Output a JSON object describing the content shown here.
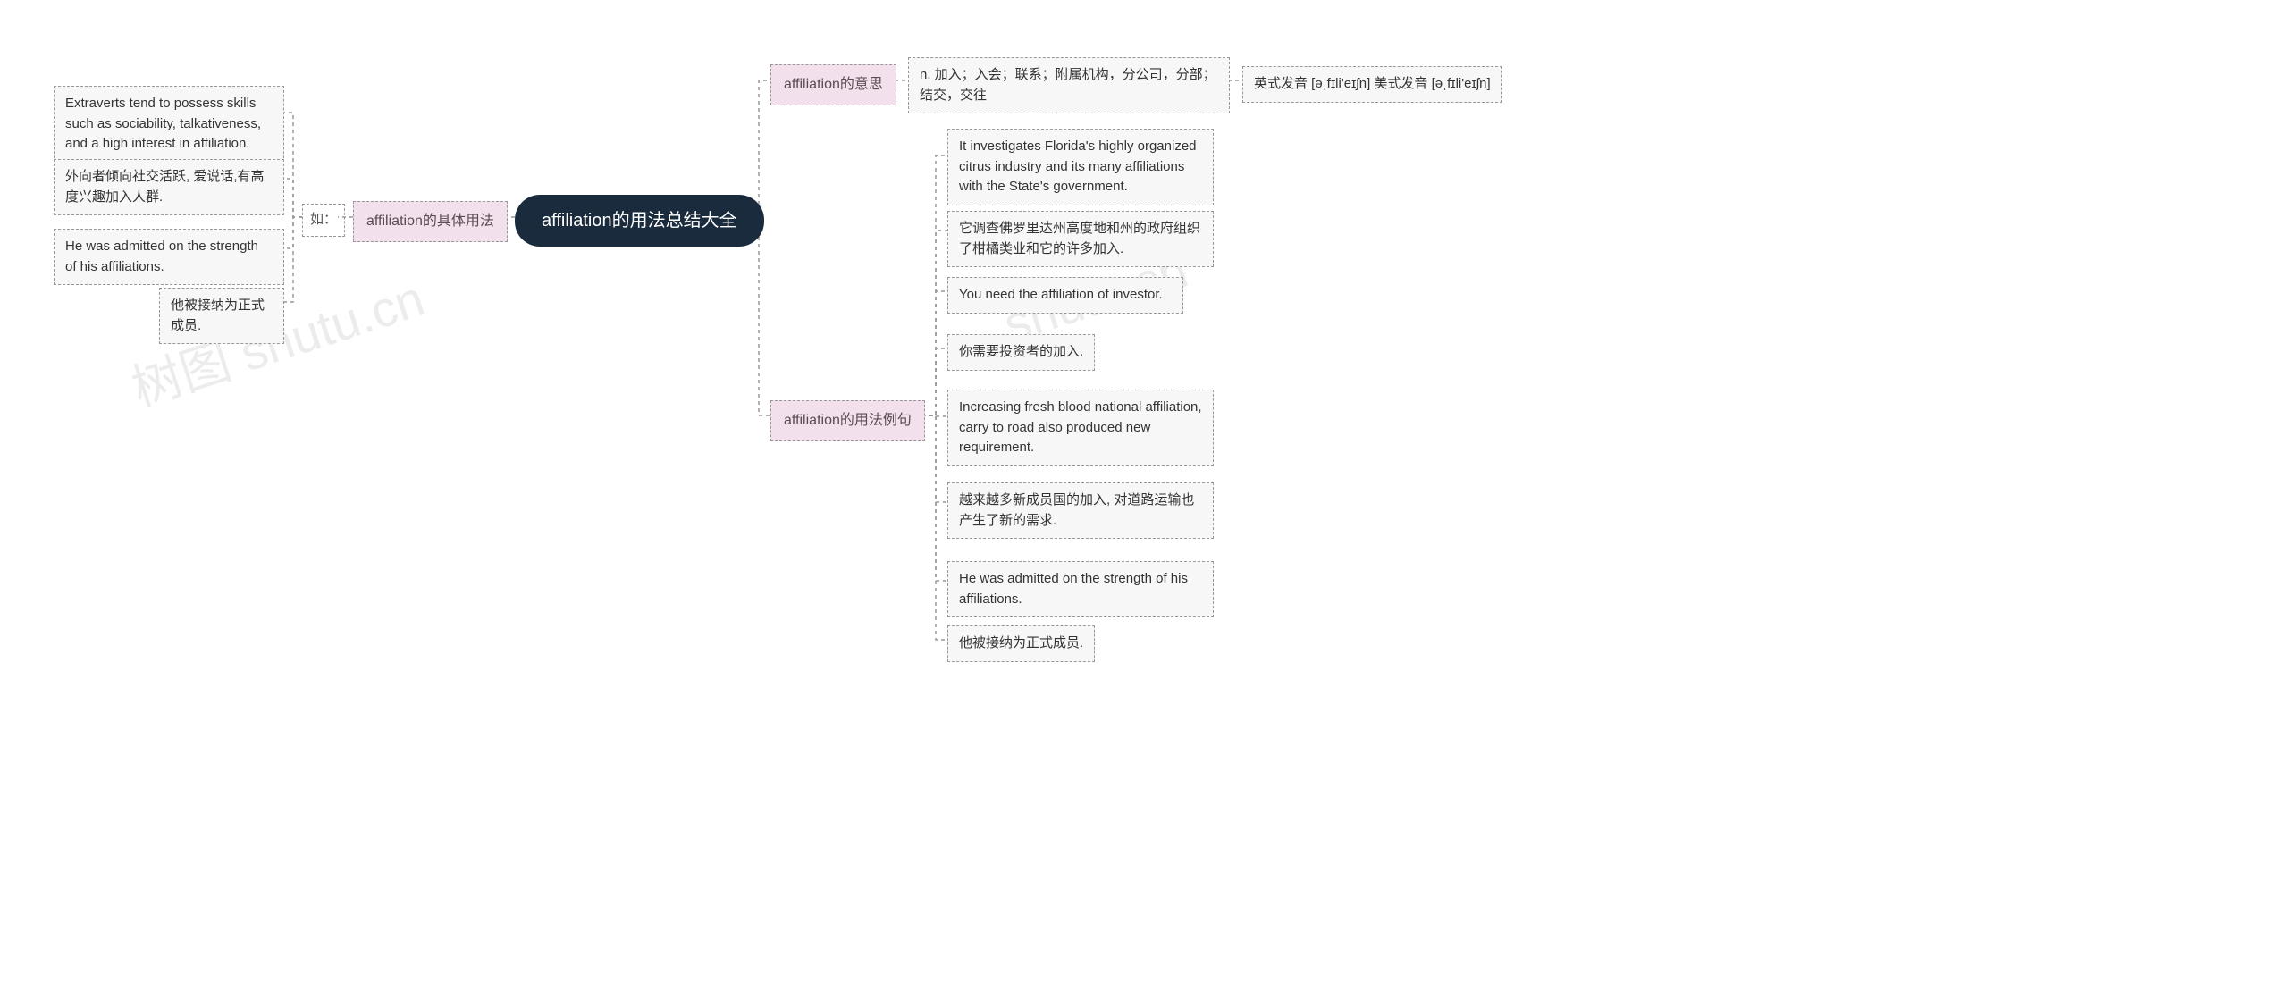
{
  "root": {
    "title": "affiliation的用法总结大全"
  },
  "branches": {
    "usage": {
      "title": "affiliation的具体用法",
      "connector": "如：",
      "items": [
        "Extraverts tend to possess skills such as sociability, talkativeness, and a high interest in affiliation.",
        "外向者倾向社交活跃, 爱说话,有高度兴趣加入人群.",
        "He was admitted on the strength of his affiliations.",
        "他被接纳为正式成员."
      ]
    },
    "meaning": {
      "title": "affiliation的意思",
      "definition": "n. 加入；入会；联系；附属机构，分公司，分部；结交，交往",
      "pronunciation": "英式发音 [əˌfɪli'eɪʃn] 美式发音 [əˌfɪli'eɪʃn]"
    },
    "examples": {
      "title": "affiliation的用法例句",
      "items": [
        "It investigates Florida's highly organized citrus industry and its many affiliations with the State's government.",
        "它调查佛罗里达州高度地和州的政府组织了柑橘类业和它的许多加入.",
        "You need the affiliation of investor.",
        "你需要投资者的加入.",
        "Increasing fresh blood national affiliation, carry to road also produced new requirement.",
        "越来越多新成员国的加入, 对道路运输也产生了新的需求.",
        "He was admitted on the strength of his affiliations.",
        "他被接纳为正式成员."
      ]
    }
  },
  "watermarks": [
    "树图 shutu.cn",
    "shutu.cn"
  ]
}
